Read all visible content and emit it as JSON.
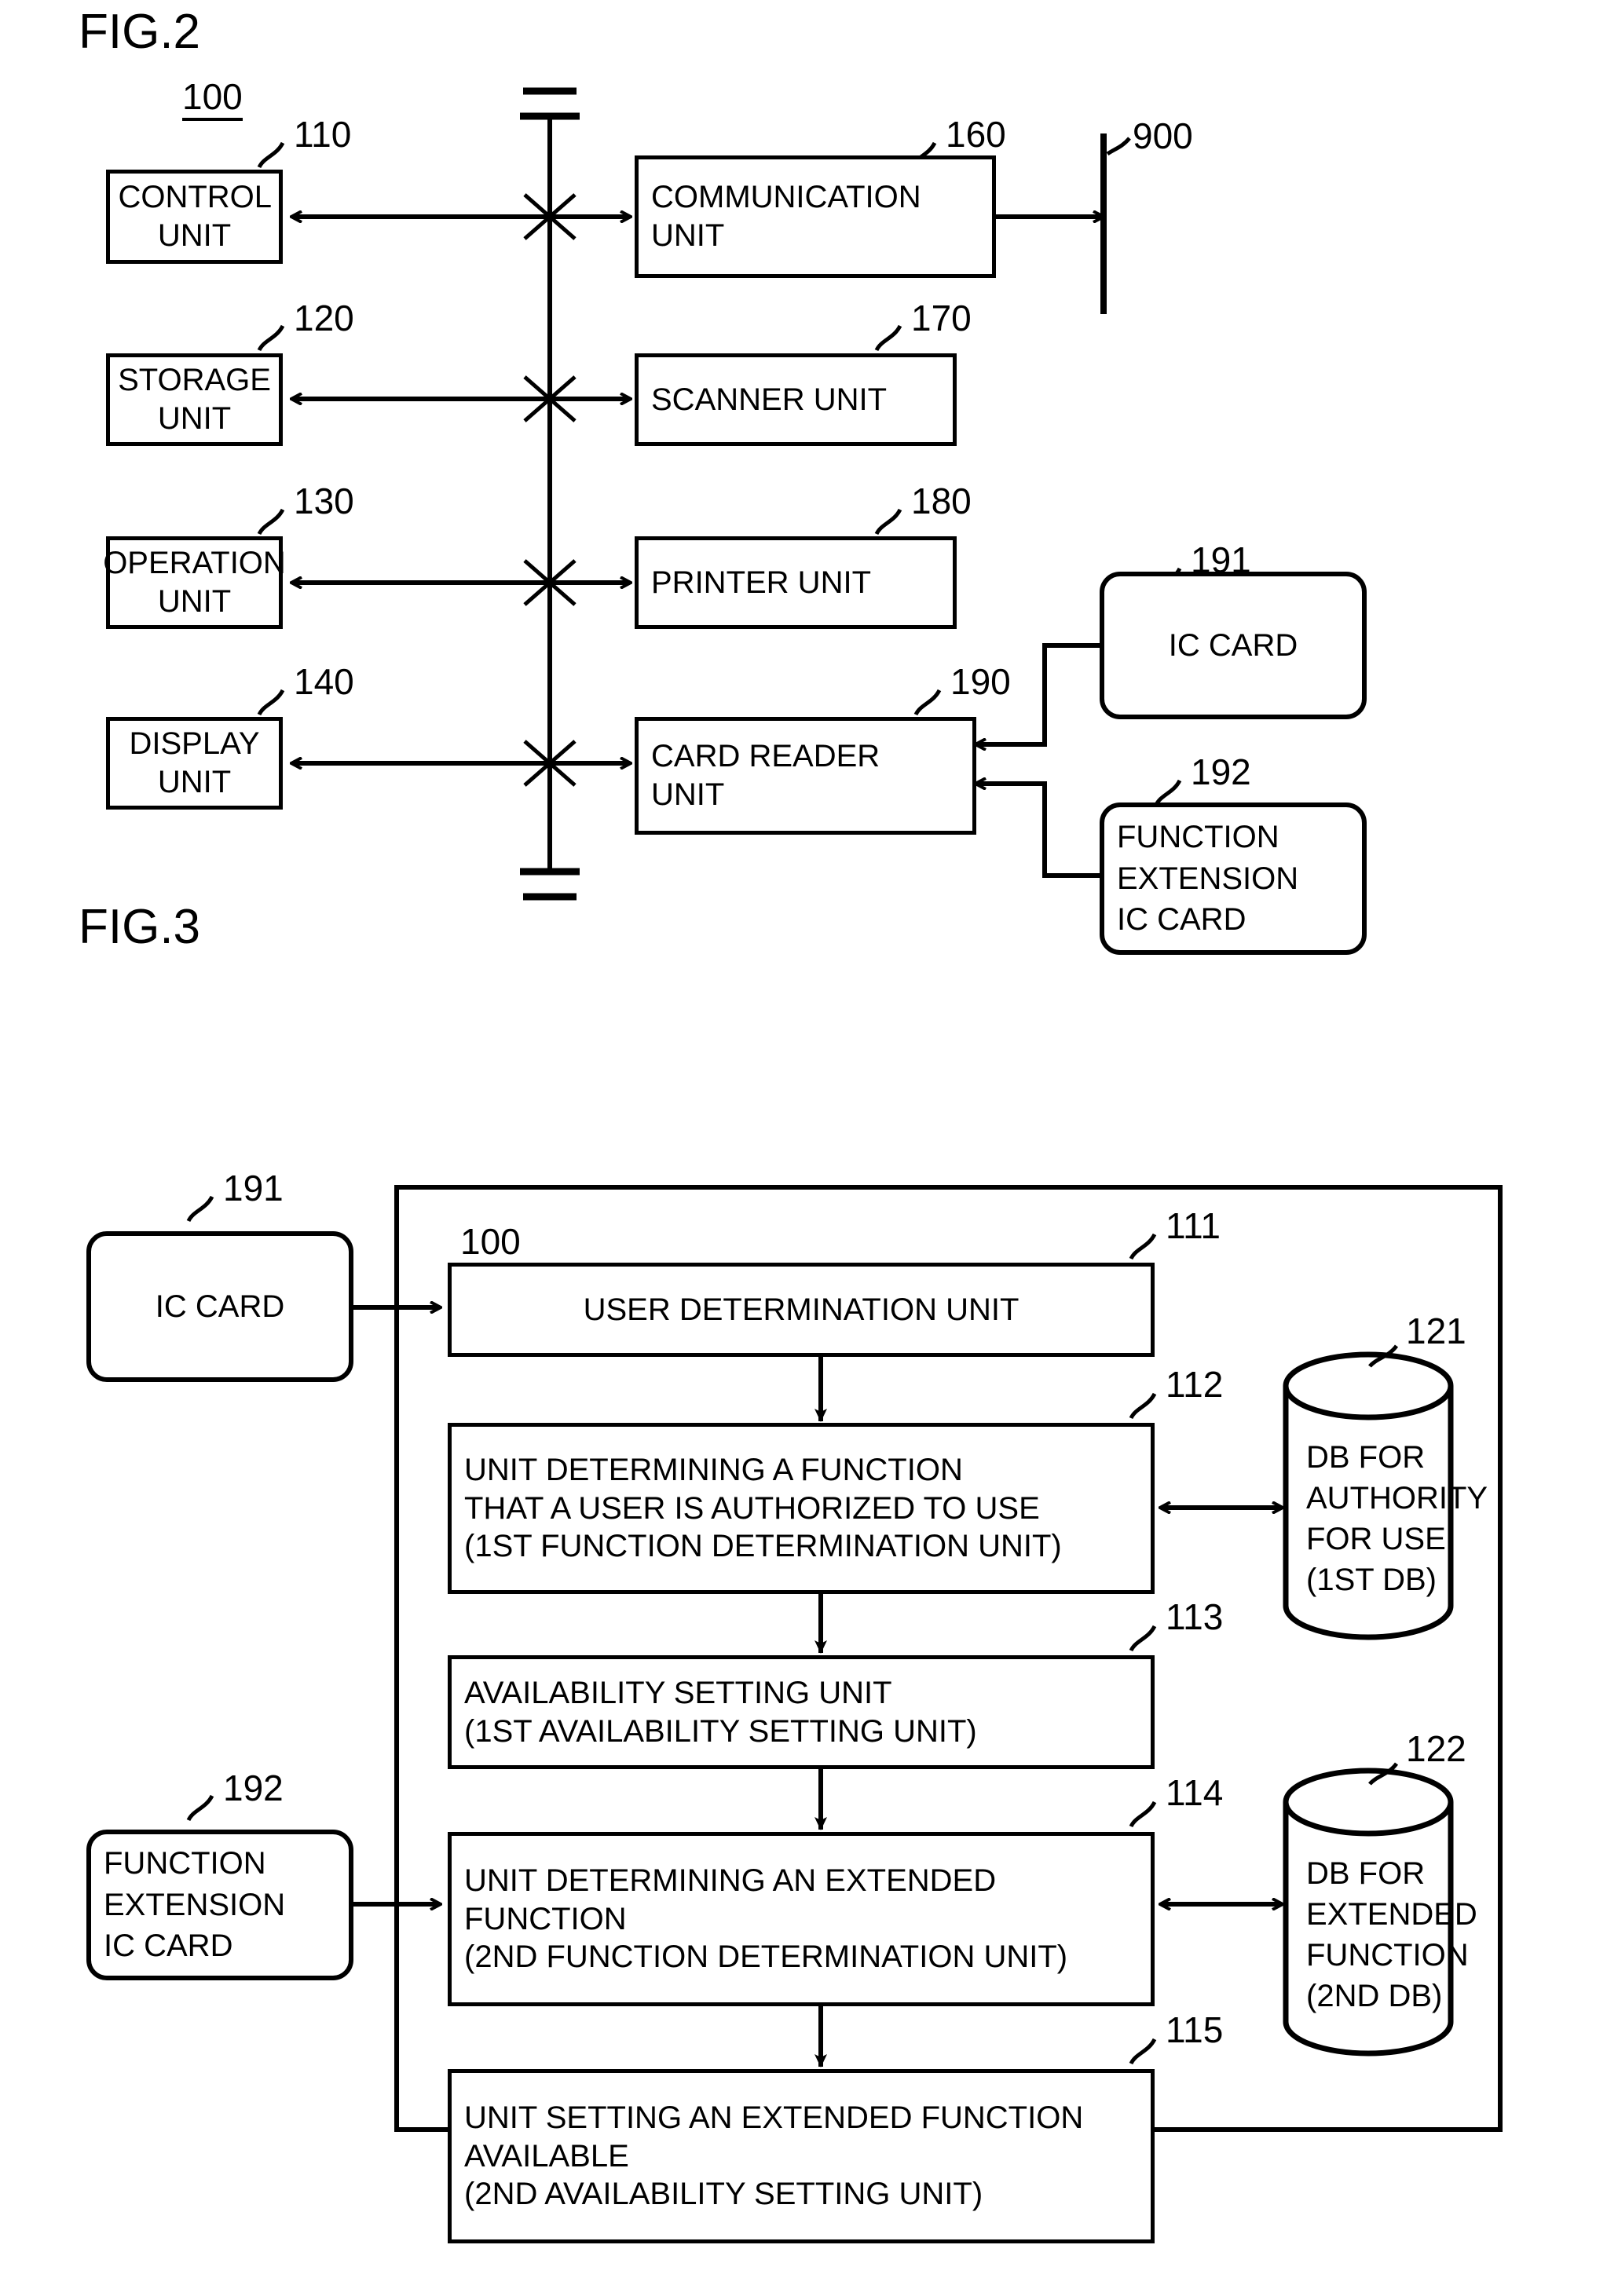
{
  "figures": {
    "fig2": {
      "caption": "FIG.2",
      "system_ref": "100",
      "network_ref": "900",
      "blocks": [
        {
          "ref": "110",
          "label": "CONTROL UNIT"
        },
        {
          "ref": "120",
          "label": "STORAGE UNIT"
        },
        {
          "ref": "130",
          "label": "OPERATION UNIT"
        },
        {
          "ref": "140",
          "label": "DISPLAY UNIT"
        },
        {
          "ref": "160",
          "label": "COMMUNICATION\nUNIT"
        },
        {
          "ref": "170",
          "label": "SCANNER UNIT"
        },
        {
          "ref": "180",
          "label": "PRINTER UNIT"
        },
        {
          "ref": "190",
          "label": "CARD READER\nUNIT"
        }
      ],
      "cards": [
        {
          "ref": "191",
          "label": "IC CARD"
        },
        {
          "ref": "192",
          "label": "FUNCTION\nEXTENSION\nIC CARD"
        }
      ]
    },
    "fig3": {
      "caption": "FIG.3",
      "system_ref": "100",
      "cards": [
        {
          "ref": "191",
          "label": "IC CARD"
        },
        {
          "ref": "192",
          "label": "FUNCTION\nEXTENSION\nIC CARD"
        }
      ],
      "blocks": [
        {
          "ref": "111",
          "label": "USER DETERMINATION UNIT"
        },
        {
          "ref": "112",
          "label": "UNIT DETERMINING A FUNCTION\nTHAT A USER IS AUTHORIZED TO USE\n(1ST FUNCTION DETERMINATION UNIT)"
        },
        {
          "ref": "113",
          "label": "AVAILABILITY SETTING UNIT\n(1ST AVAILABILITY SETTING UNIT)"
        },
        {
          "ref": "114",
          "label": "UNIT DETERMINING AN EXTENDED\nFUNCTION\n(2ND FUNCTION DETERMINATION UNIT)"
        },
        {
          "ref": "115",
          "label": "UNIT SETTING AN EXTENDED FUNCTION\nAVAILABLE\n(2ND AVAILABILITY SETTING UNIT)"
        }
      ],
      "databases": [
        {
          "ref": "121",
          "label": "DB FOR\nAUTHORITY\nFOR USE\n(1ST DB)"
        },
        {
          "ref": "122",
          "label": "DB FOR\nEXTENDED\nFUNCTION\n(2ND DB)"
        }
      ]
    }
  },
  "colors": {
    "ink": "#000000",
    "paper": "#ffffff"
  }
}
